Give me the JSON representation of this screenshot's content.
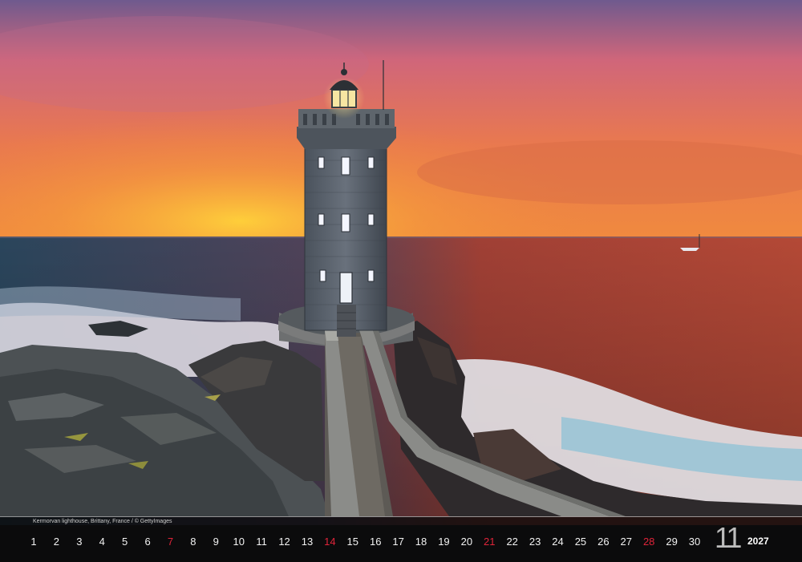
{
  "photo": {
    "subject": "lighthouse-on-rocky-coast-at-sunset",
    "colors": {
      "sky_top": "#7b5a86",
      "sky_mid": "#e77a52",
      "sky_glow": "#f5b23a",
      "sea": "#3c5a6e",
      "sea_red": "#c0443a",
      "rock": "#4a4f52",
      "tower": "#5b6470",
      "lamp": "#ffe9a0"
    }
  },
  "caption": "Kermorvan lighthouse, Brittany, France / © GettyImages",
  "calendar": {
    "days": [
      {
        "n": "1",
        "sunday": false
      },
      {
        "n": "2",
        "sunday": false
      },
      {
        "n": "3",
        "sunday": false
      },
      {
        "n": "4",
        "sunday": false
      },
      {
        "n": "5",
        "sunday": false
      },
      {
        "n": "6",
        "sunday": false
      },
      {
        "n": "7",
        "sunday": true
      },
      {
        "n": "8",
        "sunday": false
      },
      {
        "n": "9",
        "sunday": false
      },
      {
        "n": "10",
        "sunday": false
      },
      {
        "n": "11",
        "sunday": false
      },
      {
        "n": "12",
        "sunday": false
      },
      {
        "n": "13",
        "sunday": false
      },
      {
        "n": "14",
        "sunday": true
      },
      {
        "n": "15",
        "sunday": false
      },
      {
        "n": "16",
        "sunday": false
      },
      {
        "n": "17",
        "sunday": false
      },
      {
        "n": "18",
        "sunday": false
      },
      {
        "n": "19",
        "sunday": false
      },
      {
        "n": "20",
        "sunday": false
      },
      {
        "n": "21",
        "sunday": true
      },
      {
        "n": "22",
        "sunday": false
      },
      {
        "n": "23",
        "sunday": false
      },
      {
        "n": "24",
        "sunday": false
      },
      {
        "n": "25",
        "sunday": false
      },
      {
        "n": "26",
        "sunday": false
      },
      {
        "n": "27",
        "sunday": false
      },
      {
        "n": "28",
        "sunday": true
      },
      {
        "n": "29",
        "sunday": false
      },
      {
        "n": "30",
        "sunday": false
      }
    ],
    "month_number": "11",
    "year": "2027",
    "sunday_color": "#e0243a"
  }
}
